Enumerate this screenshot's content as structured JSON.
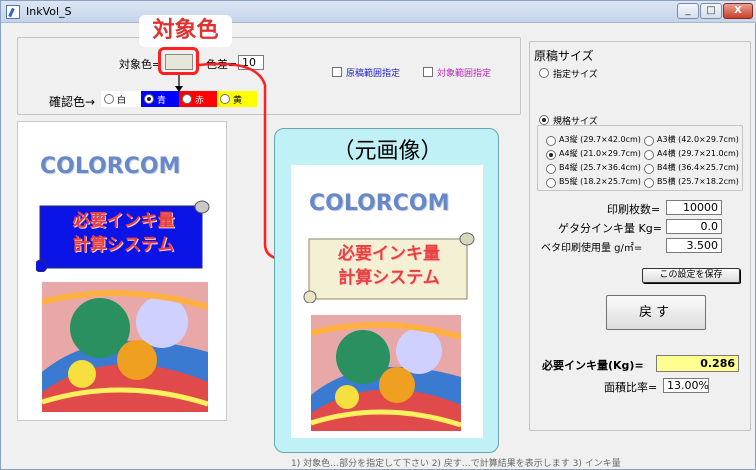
{
  "window": {
    "title": "InkVol_S",
    "min": "_",
    "max": "□",
    "close": "X"
  },
  "callout": {
    "title": "対象色",
    "original_image_label": "（元画像）"
  },
  "target": {
    "label": "対象色=",
    "swatch_color": "#e5e7d8",
    "diff_label": "色差=",
    "diff_value": "10"
  },
  "range_checks": {
    "original_range": "原稿範囲指定",
    "target_range": "対象範囲指定"
  },
  "confirm_color": {
    "label": "確認色→",
    "options": [
      {
        "label": "白",
        "bg": "#ffffff",
        "fg": "#000000",
        "checked": false
      },
      {
        "label": "青",
        "bg": "#0000ff",
        "fg": "#ffffff",
        "checked": true
      },
      {
        "label": "赤",
        "bg": "#ff0000",
        "fg": "#ffffff",
        "checked": false
      },
      {
        "label": "黄",
        "bg": "#ffff00",
        "fg": "#000000",
        "checked": false
      }
    ]
  },
  "preview": {
    "brand": "COLORCOM",
    "scroll_line1": "必要インキ量",
    "scroll_line2": "計算システム"
  },
  "paper": {
    "group_label": "原稿サイズ",
    "specify": "指定サイズ",
    "standard": "規格サイズ",
    "sizes": [
      {
        "label": "A3縦 (29.7×42.0cm)",
        "checked": false
      },
      {
        "label": "A3横 (42.0×29.7cm)",
        "checked": false
      },
      {
        "label": "A4縦 (21.0×29.7cm)",
        "checked": true
      },
      {
        "label": "A4横 (29.7×21.0cm)",
        "checked": false
      },
      {
        "label": "B4縦 (25.7×36.4cm)",
        "checked": false
      },
      {
        "label": "B4横 (36.4×25.7cm)",
        "checked": false
      },
      {
        "label": "B5縦 (18.2×25.7cm)",
        "checked": false
      },
      {
        "label": "B5横 (25.7×18.2cm)",
        "checked": false
      }
    ]
  },
  "settings": {
    "print_count_label": "印刷枚数=",
    "print_count": "10000",
    "geta_label": "ゲタ分インキ量 Kg=",
    "geta_value": "0.0",
    "solid_label": "ベタ印刷使用量 g/㎡=",
    "solid_value": "3.500",
    "save_button": "この設定を保存"
  },
  "back_button": "戻す",
  "results": {
    "ink_label": "必要インキ量(Kg)=",
    "ink_value": "0.286",
    "area_label": "面積比率=",
    "area_value": "13.00%"
  },
  "status_text": "1) 対象色…部分を指定して下さい  2) 戻す…で計算結果を表示します  3) インキ量"
}
